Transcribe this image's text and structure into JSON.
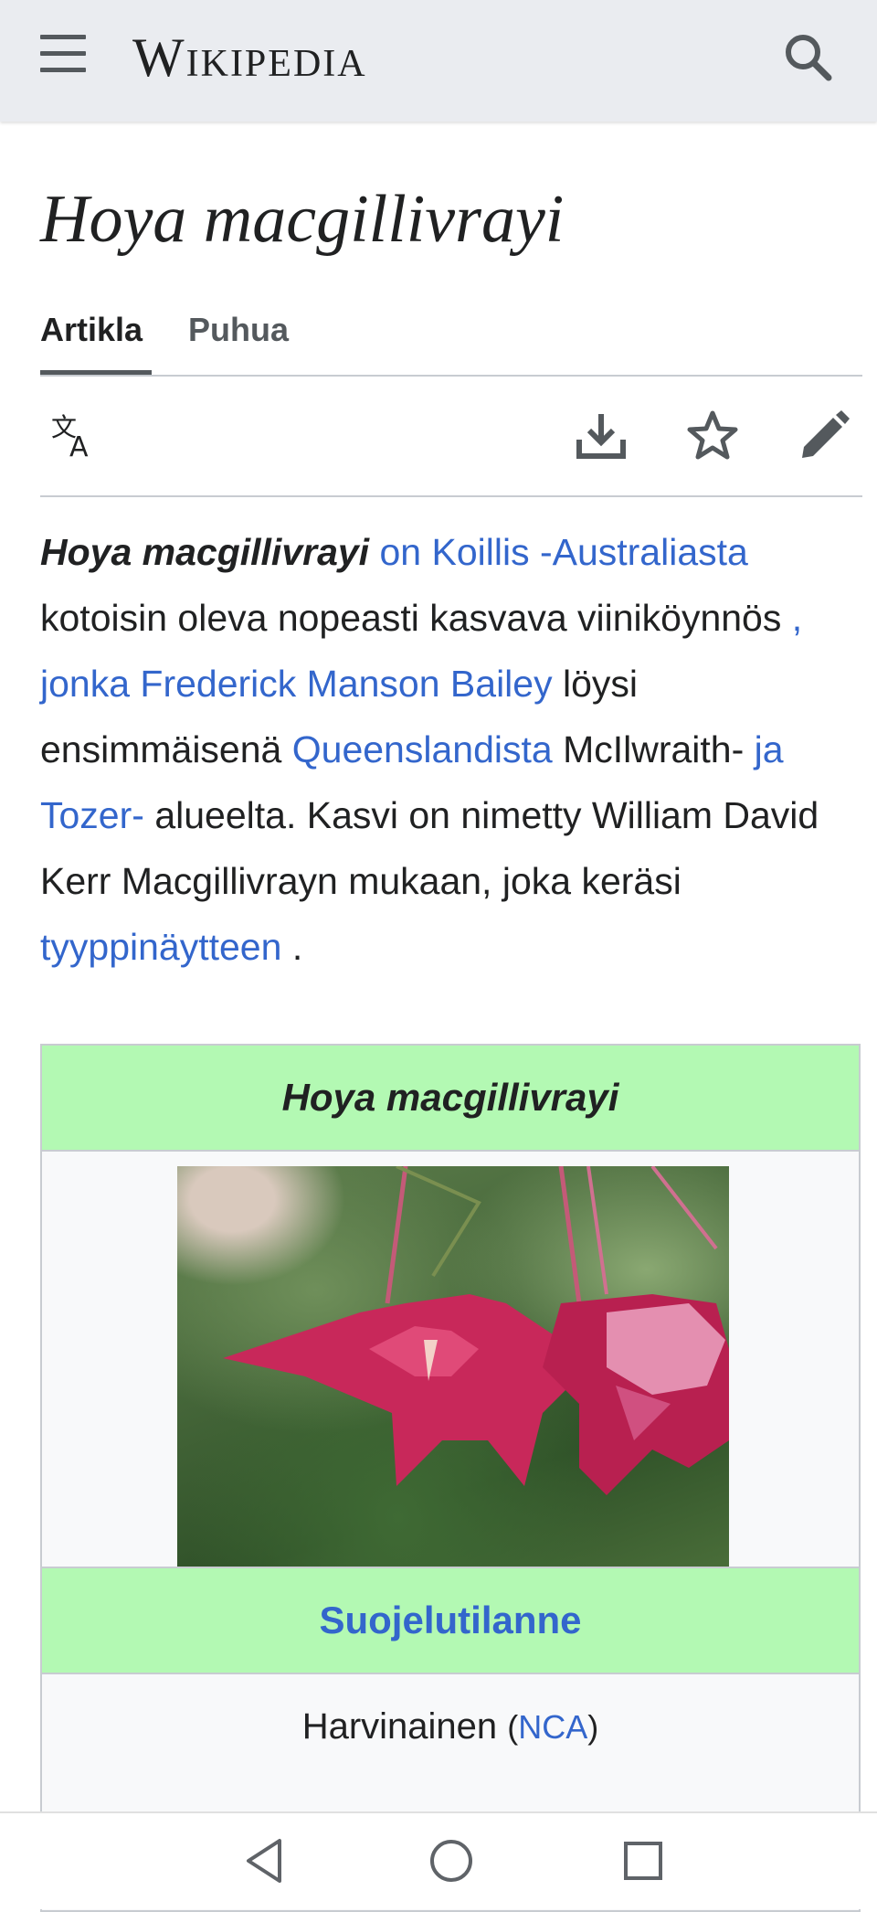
{
  "header": {
    "wordmark": "Wikipedia",
    "menu_icon": "hamburger-menu-icon",
    "search_icon": "search-icon"
  },
  "page": {
    "title": "Hoya macgillivrayi"
  },
  "tabs": [
    {
      "label": "Artikla",
      "active": true
    },
    {
      "label": "Puhua",
      "active": false
    }
  ],
  "toolbar": {
    "language_icon": "language-icon",
    "download_icon": "download-icon",
    "watch_icon": "star-icon",
    "edit_icon": "edit-pencil-icon"
  },
  "intro": {
    "t1": "Hoya macgillivrayi",
    "l1": "on Koillis -Australiasta",
    "t2": "kotoisin oleva nopeasti kasvava viiniköynnös",
    "l2": ", jonka Frederick Manson Bailey",
    "t3": "löysi ensimmäisenä",
    "l3": "Queenslandista",
    "t4": "McIlwraith-",
    "l4": "ja Tozer-",
    "t5": "alueelta. Kasvi on nimetty William David Kerr Macgillivrayn mukaan, joka keräsi",
    "l5": "tyyppinäytteen",
    "t6": "."
  },
  "infobox": {
    "title": "Hoya macgillivrayi",
    "image_alt": "Hoya macgillivrayi flower photo",
    "status_header": "Suojelutilanne",
    "status_value": "Harvinainen",
    "status_paren_open": "(",
    "status_link": "NCA",
    "status_paren_close": ")"
  },
  "colors": {
    "header_bg": "#eaecf0",
    "link": "#3366cc",
    "infobox_header_bg": "#b3f9b3",
    "text": "#202122"
  },
  "navbar": {
    "back_icon": "back-triangle-icon",
    "home_icon": "home-circle-icon",
    "recents_icon": "recents-square-icon"
  }
}
